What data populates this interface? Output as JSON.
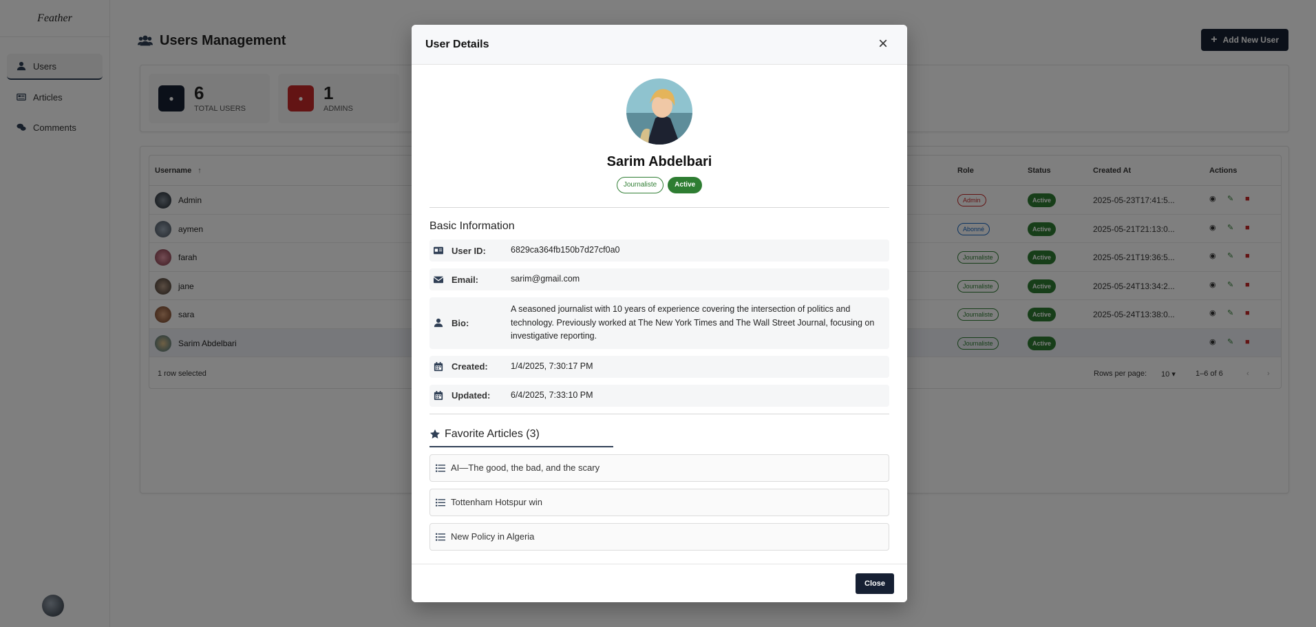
{
  "sidebar": {
    "logo": "Feather",
    "items": [
      {
        "label": "Users"
      },
      {
        "label": "Articles"
      },
      {
        "label": "Comments"
      }
    ]
  },
  "header": {
    "title": "Users Management",
    "add_button": "Add New User"
  },
  "stats": [
    {
      "value": "6",
      "label": "TOTAL USERS",
      "color": "#162033"
    },
    {
      "value": "1",
      "label": "ADMINS",
      "color": "#c62828"
    }
  ],
  "table": {
    "columns": {
      "username": "Username",
      "role": "Role",
      "status": "Status",
      "created_at": "Created At",
      "actions": "Actions"
    },
    "rows": [
      {
        "name": "Admin",
        "role": "Admin",
        "status": "Active",
        "created": "2025-05-23T17:41:5..."
      },
      {
        "name": "aymen",
        "role": "Abonné",
        "status": "Active",
        "created": "2025-05-21T21:13:0..."
      },
      {
        "name": "farah",
        "role": "Journaliste",
        "status": "Active",
        "created": "2025-05-21T19:36:5..."
      },
      {
        "name": "jane",
        "role": "Journaliste",
        "status": "Active",
        "created": "2025-05-24T13:34:2..."
      },
      {
        "name": "sara",
        "role": "Journaliste",
        "status": "Active",
        "created": "2025-05-24T13:38:0..."
      },
      {
        "name": "Sarim Abdelbari",
        "role": "Journaliste",
        "status": "Active",
        "created": ""
      }
    ],
    "footer": {
      "selected": "1 row selected",
      "rows_per_page_label": "Rows per page:",
      "rows_per_page": "10",
      "range": "1–6 of 6"
    }
  },
  "modal": {
    "title": "User Details",
    "name": "Sarim Abdelbari",
    "role_chip": "Journaliste",
    "status_chip": "Active",
    "basic_info_title": "Basic Information",
    "fields": {
      "user_id": {
        "label": "User ID:",
        "value": "6829ca364fb150b7d27cf0a0"
      },
      "email": {
        "label": "Email:",
        "value": "sarim@gmail.com"
      },
      "bio": {
        "label": "Bio:",
        "value": "A seasoned journalist with 10 years of experience covering the intersection of politics and technology. Previously worked at The New York Times and The Wall Street Journal, focusing on investigative reporting."
      },
      "created": {
        "label": "Created:",
        "value": "1/4/2025, 7:30:17 PM"
      },
      "updated": {
        "label": "Updated:",
        "value": "6/4/2025, 7:33:10 PM"
      }
    },
    "favorites_title": "Favorite Articles (3)",
    "favorites": [
      {
        "title": "AI—The good, the bad, and the scary"
      },
      {
        "title": "Tottenham Hotspur win"
      },
      {
        "title": "New Policy in Algeria"
      }
    ],
    "close_button": "Close"
  },
  "colors": {
    "primary": "#162033",
    "success": "#2e7d32",
    "admin": "#c62828",
    "subscriber": "#1565c0"
  }
}
